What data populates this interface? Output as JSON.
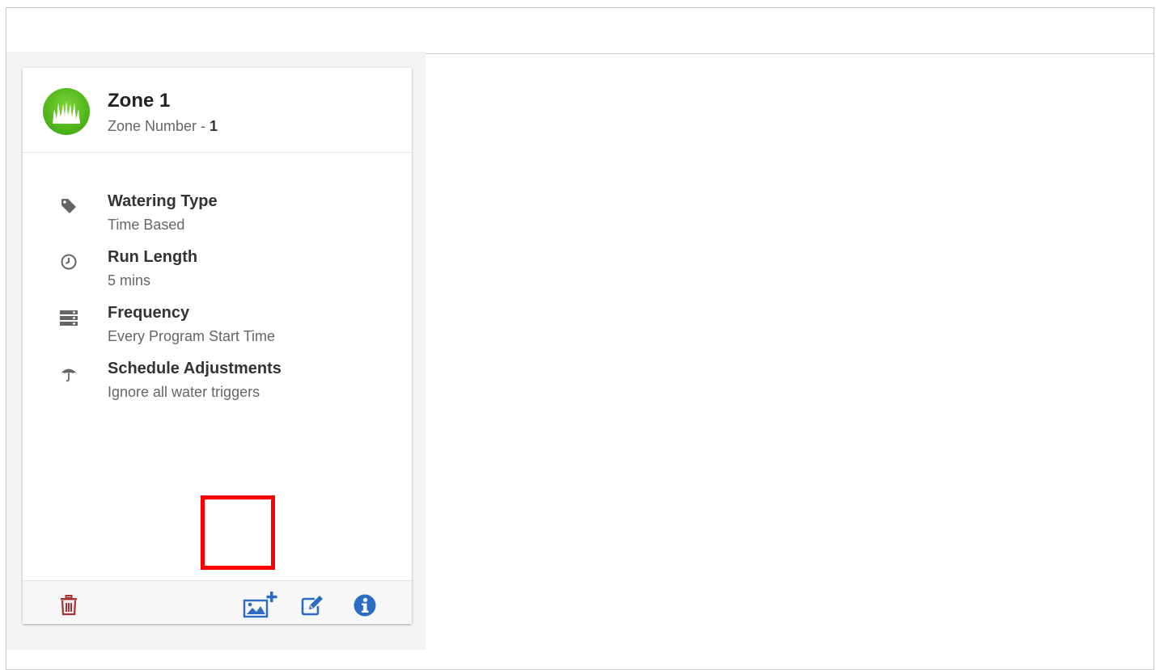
{
  "zone": {
    "title": "Zone 1",
    "number_prefix": "Zone Number - ",
    "number": "1"
  },
  "details": [
    {
      "icon": "tag-icon",
      "label": "Watering Type",
      "value": "Time Based"
    },
    {
      "icon": "clock-icon",
      "label": "Run Length",
      "value": "5 mins"
    },
    {
      "icon": "server-icon",
      "label": "Frequency",
      "value": "Every Program Start Time"
    },
    {
      "icon": "umbrella-icon",
      "label": "Schedule Adjustments",
      "value": "Ignore all water triggers"
    }
  ],
  "footer": {
    "delete_icon": "trash-icon",
    "add_image_icon": "image-plus-icon",
    "edit_icon": "edit-icon",
    "info_icon": "info-icon"
  },
  "colors": {
    "accent_blue": "#2b6cc4",
    "delete_red": "#a83232",
    "grass_green": "#4fb61b",
    "highlight_red": "#ff0000"
  }
}
